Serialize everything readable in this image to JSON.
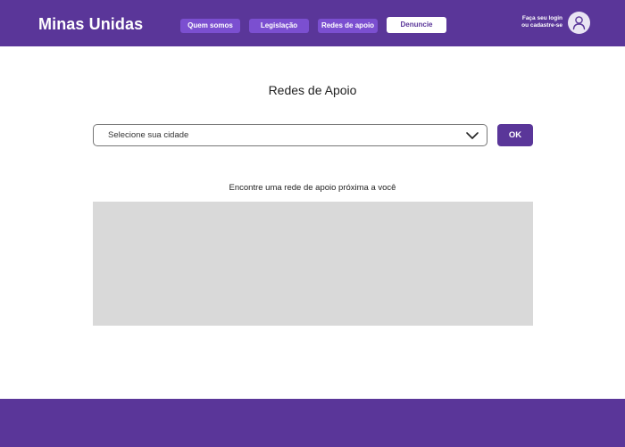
{
  "header": {
    "logo": "Minas Unidas",
    "nav": {
      "quem_somos": "Quem somos",
      "legislacao": "Legislação",
      "redes_de_apoio": "Redes de apoio",
      "denuncie": "Denuncie"
    },
    "login_line1": "Faça seu login",
    "login_line2": "ou cadastre-se",
    "avatar_icon": "user-icon"
  },
  "main": {
    "title": "Redes de Apoio",
    "city_select_placeholder": "Selecione sua cidade",
    "select_icon": "chevron-down-icon",
    "ok_label": "OK",
    "hint": "Encontre uma rede de apoio próxima a você"
  },
  "colors": {
    "brand_purple": "#5a3699",
    "nav_button": "#7b4fd0",
    "map_placeholder": "#d9d9d9"
  }
}
